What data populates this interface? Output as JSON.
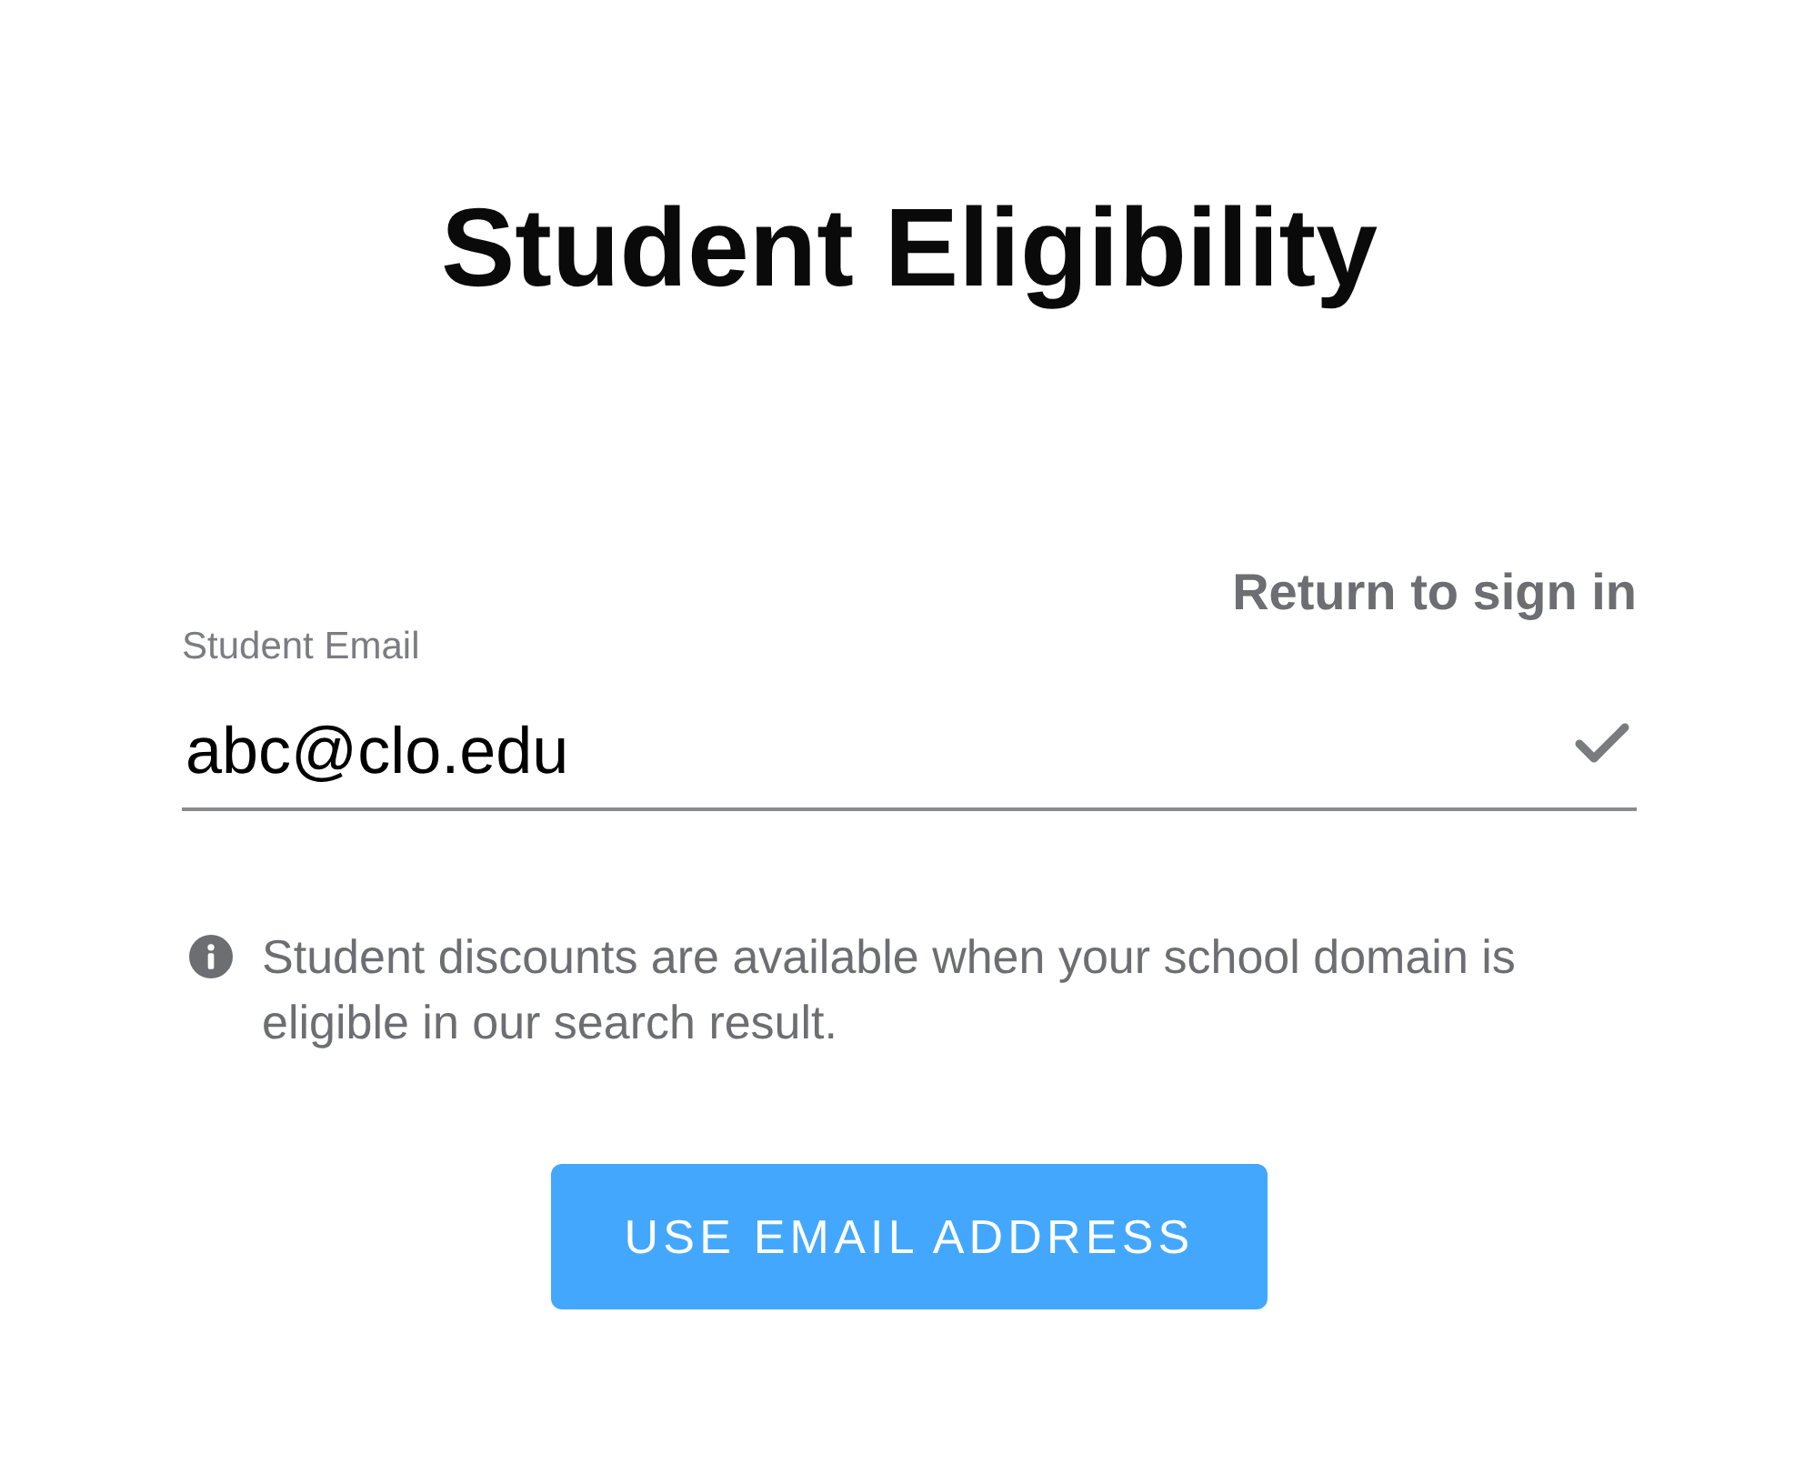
{
  "title": "Student Eligibility",
  "return_link": "Return to sign in",
  "email_field": {
    "label": "Student Email",
    "value": "abc@clo.edu",
    "valid": true
  },
  "info_note": "Student discounts are available when your school domain is eligible in our search result.",
  "submit_button": "USE EMAIL ADDRESS"
}
